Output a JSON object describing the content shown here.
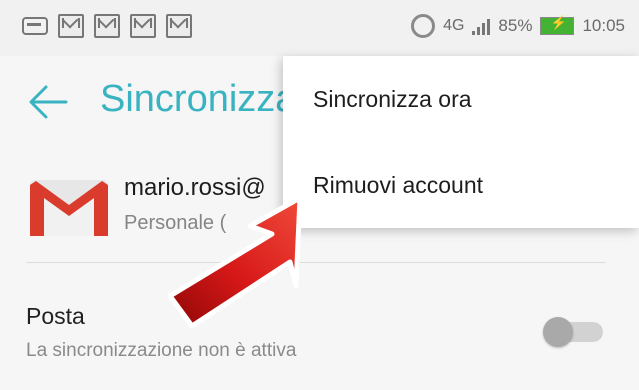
{
  "status_bar": {
    "left_icons": [
      "voicemail-icon",
      "gmail-notification-icon",
      "gmail-notification-icon",
      "gmail-notification-icon",
      "gmail-notification-icon"
    ],
    "network": "4G",
    "battery_percent": "85%",
    "time": "10:05"
  },
  "toolbar": {
    "title": "Sincronizza"
  },
  "account": {
    "email": "mario.rossi@",
    "type": "Personale ("
  },
  "sync_item": {
    "label": "Posta",
    "status": "La sincronizzazione non è attiva",
    "enabled": false
  },
  "menu": {
    "items": [
      {
        "label": "Sincronizza ora"
      },
      {
        "label": "Rimuovi account"
      }
    ]
  },
  "colors": {
    "accent": "#39b3c1",
    "gmail_red": "#d93b2d",
    "battery": "#44b233",
    "arrow": "#c50f0f"
  }
}
